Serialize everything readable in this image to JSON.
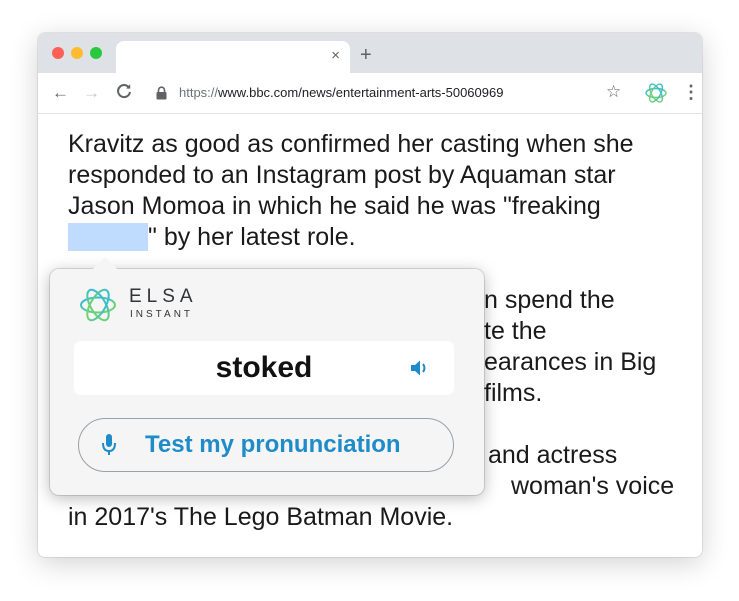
{
  "browser": {
    "tab_close_glyph": "×",
    "new_tab_glyph": "+",
    "url_scheme": "https://",
    "url_rest": "www.bbc.com/news/entertainment-arts-50060969",
    "icons": [
      "back-arrow-icon",
      "forward-arrow-icon",
      "reload-icon",
      "lock-icon",
      "star-icon",
      "elsa-extension-icon",
      "menu-icon"
    ]
  },
  "article": {
    "p1_before": "Kravitz as good as confirmed her casting when she responded to an Instagram post by Aquaman star Jason Momoa in which he said he was \"freaking ",
    "p1_after": "\" by her latest role.",
    "p2_visible": [
      "n spend the",
      "te the",
      "earances in Big",
      "films."
    ],
    "p3_visible": [
      "and actress",
      "woman's voice",
      "in 2017's The Lego Batman Movie."
    ]
  },
  "popup": {
    "brand_name": "ELSA",
    "brand_sub": "INSTANT",
    "word": "stoked",
    "pronounce_button": "Test my pronunciation",
    "colors": {
      "accent": "#1f8bc9",
      "highlight": "#bfdbfe",
      "logo_gradient": [
        "#29b6e8",
        "#7ed957"
      ]
    }
  }
}
